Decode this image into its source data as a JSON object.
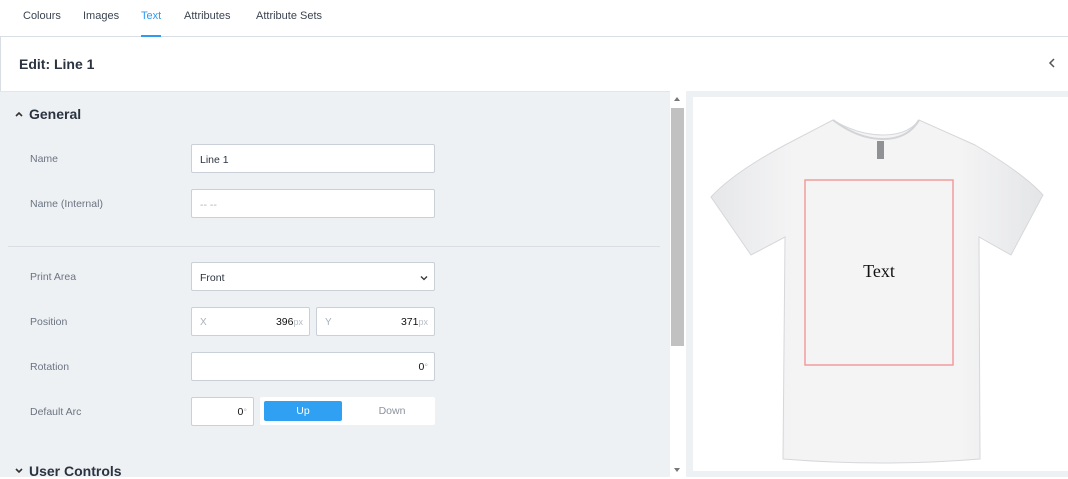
{
  "tabs": [
    {
      "label": "Colours",
      "active": false
    },
    {
      "label": "Images",
      "active": false
    },
    {
      "label": "Text",
      "active": true
    },
    {
      "label": "Attributes",
      "active": false
    },
    {
      "label": "Attribute Sets",
      "active": false
    }
  ],
  "header": {
    "title": "Edit: Line 1"
  },
  "sections": {
    "general": "General",
    "user_controls": "User Controls"
  },
  "fields": {
    "name": {
      "label": "Name",
      "value": "Line 1"
    },
    "name_internal": {
      "label": "Name (Internal)",
      "placeholder": "-- --"
    },
    "print_area": {
      "label": "Print Area",
      "value": "Front"
    },
    "position": {
      "label": "Position",
      "x_label": "X",
      "x_value": "396",
      "y_label": "Y",
      "y_value": "371",
      "unit": "px"
    },
    "rotation": {
      "label": "Rotation",
      "value": "0",
      "unit": "°"
    },
    "default_arc": {
      "label": "Default Arc",
      "value": "0",
      "unit": "°",
      "up_label": "Up",
      "down_label": "Down"
    }
  },
  "preview": {
    "text": "Text",
    "print_area_color": "#f29b9b",
    "accent": "#30a0f2"
  }
}
